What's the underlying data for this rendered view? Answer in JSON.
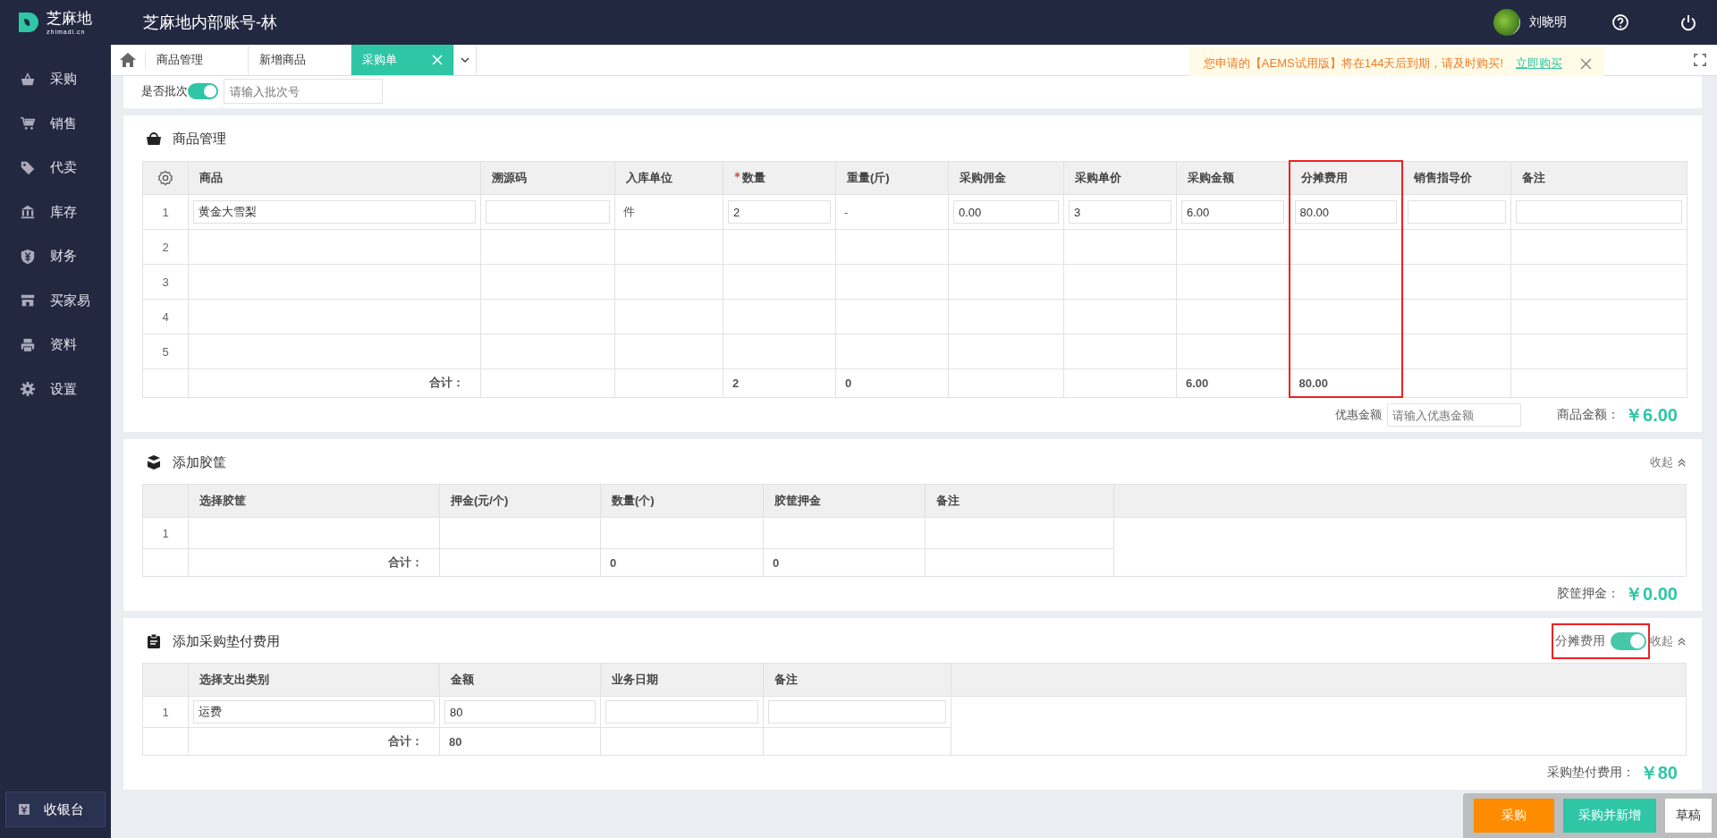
{
  "app": {
    "logo_text": "芝麻地",
    "logo_subtext": "zhimadi.cn",
    "account_title": "芝麻地内部账号-林"
  },
  "user": {
    "name": "刘晓明"
  },
  "sidebar": {
    "items": [
      {
        "label": "采购"
      },
      {
        "label": "销售"
      },
      {
        "label": "代卖"
      },
      {
        "label": "库存"
      },
      {
        "label": "财务"
      },
      {
        "label": "买家易"
      },
      {
        "label": "资料"
      },
      {
        "label": "设置"
      }
    ],
    "cashier_button": "收银台"
  },
  "tabs": [
    {
      "label": "商品管理",
      "selected": false
    },
    {
      "label": "新增商品",
      "selected": false
    },
    {
      "label": "采购单",
      "selected": true
    }
  ],
  "notice": {
    "text": "您申请的【AEMS试用版】将在144天后到期，请及时购买!",
    "link": "立即购买"
  },
  "batch": {
    "label": "是否批次",
    "on": true,
    "placeholder": "请输入批次号"
  },
  "sections": [
    {
      "kind": "goods",
      "title": "商品管理",
      "columns": [
        {
          "label": "商品",
          "required": false,
          "highlighted": false
        },
        {
          "label": "溯源码",
          "required": false,
          "highlighted": false
        },
        {
          "label": "入库单位",
          "required": false,
          "highlighted": false
        },
        {
          "label": "数量",
          "required": true,
          "highlighted": false
        },
        {
          "label": "重量(斤)",
          "required": false,
          "highlighted": false
        },
        {
          "label": "采购佣金",
          "required": false,
          "highlighted": false
        },
        {
          "label": "采购单价",
          "required": false,
          "highlighted": false
        },
        {
          "label": "采购金额",
          "required": false,
          "highlighted": false
        },
        {
          "label": "分摊费用",
          "required": false,
          "highlighted": true
        },
        {
          "label": "销售指导价",
          "required": false,
          "highlighted": false
        },
        {
          "label": "备注",
          "required": false,
          "highlighted": false
        }
      ],
      "rows": [
        {
          "index": "1",
          "cells": [
            {
              "kind": "input",
              "value": "黄金大雪梨"
            },
            {
              "kind": "input"
            },
            {
              "kind": "text",
              "value": "件"
            },
            {
              "kind": "input",
              "value": "2"
            },
            {
              "kind": "text",
              "value": "-"
            },
            {
              "kind": "input",
              "value": "0.00"
            },
            {
              "kind": "input",
              "value": "3"
            },
            {
              "kind": "input",
              "value": "6.00"
            },
            {
              "kind": "input",
              "value": "80.00"
            },
            {
              "kind": "input"
            },
            {
              "kind": "input"
            }
          ]
        },
        {
          "index": "2"
        },
        {
          "index": "3"
        },
        {
          "index": "4"
        },
        {
          "index": "5"
        }
      ],
      "totals": [
        {
          "kind": "label",
          "value": "合计："
        },
        {
          "kind": "empty"
        },
        {
          "kind": "empty"
        },
        {
          "kind": "text",
          "value": "2"
        },
        {
          "kind": "text",
          "value": "0"
        },
        {
          "kind": "empty"
        },
        {
          "kind": "empty"
        },
        {
          "kind": "text",
          "value": "6.00"
        },
        {
          "kind": "text",
          "value": "80.00"
        },
        {
          "kind": "empty"
        },
        {
          "kind": "empty"
        }
      ],
      "discount": {
        "label": "优惠金额",
        "placeholder": "请输入优惠金额"
      },
      "amount": {
        "label": "商品金额：",
        "value": "￥6.00"
      }
    },
    {
      "kind": "crates",
      "title": "添加胶筐",
      "collapse_label": "收起",
      "columns": [
        {
          "label": "选择胶筐",
          "required": false,
          "highlighted": false
        },
        {
          "label": "押金(元/个)",
          "required": false,
          "highlighted": false
        },
        {
          "label": "数量(个)",
          "required": false,
          "highlighted": false
        },
        {
          "label": "胶筐押金",
          "required": false,
          "highlighted": false
        },
        {
          "label": "备注",
          "required": false,
          "highlighted": false
        }
      ],
      "rows": [
        {
          "index": "1"
        }
      ],
      "totals": [
        {
          "kind": "label",
          "value": "合计："
        },
        {
          "kind": "empty"
        },
        {
          "kind": "text",
          "value": "0"
        },
        {
          "kind": "text",
          "value": "0"
        },
        {
          "kind": "empty"
        }
      ],
      "amount": {
        "label": "胶筐押金：",
        "value": "￥0.00"
      }
    },
    {
      "kind": "expenses",
      "title": "添加采购垫付费用",
      "collapse_label": "收起",
      "toggle": {
        "label": "分摊费用",
        "on": true,
        "highlighted": true
      },
      "columns": [
        {
          "label": "选择支出类别",
          "required": false,
          "highlighted": false
        },
        {
          "label": "金额",
          "required": false,
          "highlighted": false
        },
        {
          "label": "业务日期",
          "required": false,
          "highlighted": false
        },
        {
          "label": "备注",
          "required": false,
          "highlighted": false
        }
      ],
      "rows": [
        {
          "index": "1",
          "cells": [
            {
              "kind": "input",
              "value": "运费"
            },
            {
              "kind": "input",
              "value": "80"
            },
            {
              "kind": "input"
            },
            {
              "kind": "input"
            }
          ]
        }
      ],
      "totals": [
        {
          "kind": "label",
          "value": "合计："
        },
        {
          "kind": "text",
          "value": "80"
        },
        {
          "kind": "empty"
        },
        {
          "kind": "empty"
        }
      ],
      "amount": {
        "label": "采购垫付费用：",
        "value": "￥80"
      }
    }
  ],
  "actions": [
    {
      "label": "采购",
      "kind": "primary"
    },
    {
      "label": "采购并新增",
      "kind": "secondary"
    },
    {
      "label": "草稿",
      "kind": "plain"
    }
  ]
}
